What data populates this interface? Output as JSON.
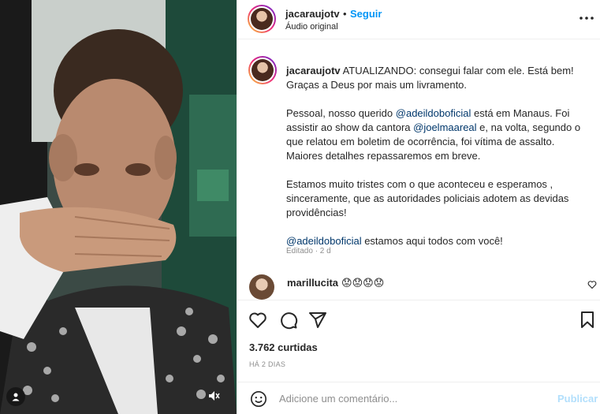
{
  "header": {
    "username": "jacaraujotv",
    "separator": "•",
    "follow_label": "Seguir",
    "audio_label": "Áudio original",
    "more_icon": "more-horizontal-icon"
  },
  "caption": {
    "username": "jacaraujotv",
    "paragraph1": "ATUALIZANDO: consegui falar com ele. Está bem! Graças a Deus por mais um livramento.",
    "p2_before": "Pessoal, nosso querido ",
    "p2_mention1": "@adeildoboficial",
    "p2_middle": " está em Manaus. Foi assistir ao show da cantora ",
    "p2_mention2": "@joelmaareal",
    "p2_after": " e, na volta, segundo o que relatou em boletim de ocorrência, foi vítima de assalto. Maiores detalhes repassaremos em breve.",
    "paragraph3": "Estamos muito tristes com o que aconteceu e esperamos , sinceramente, que as autoridades policiais adotem as devidas providências!",
    "p4_mention": "@adeildoboficial",
    "p4_after": " estamos aqui todos com você!",
    "edited_label": "Editado · 2 d"
  },
  "comment": {
    "username": "marillucita",
    "text": "😟😟😟😟"
  },
  "actions": {
    "likes": "3.762 curtidas",
    "posted_ago": "HÁ 2 DIAS"
  },
  "add_comment": {
    "placeholder": "Adicione um comentário...",
    "publish_label": "Publicar"
  },
  "colors": {
    "accent": "#0095f6",
    "mention": "#00376b",
    "muted": "#8e8e8e",
    "publish_disabled": "#b2dffc"
  }
}
